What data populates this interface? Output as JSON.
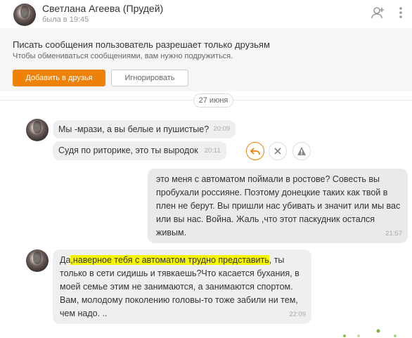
{
  "header": {
    "name": "Светлана Агеева (Прудей)",
    "status": "была в 19:45",
    "icons": [
      "add-user-icon",
      "more-icon"
    ]
  },
  "notice": {
    "title": "Писать сообщения пользователь разрешает только друзьям",
    "subtitle": "Чтобы обмениваться сообщениями, вам нужно подружиться.",
    "add_button": "Добавить в друзья",
    "ignore_button": "Игнорировать"
  },
  "date_separator": "27 июня",
  "messages": [
    {
      "from": "contact",
      "text": "Мы -мрази, а вы белые и пушистые?",
      "time": "20:09"
    },
    {
      "from": "contact",
      "text": "Судя по риторике, это ты выродок",
      "time": "20:11"
    },
    {
      "from": "me",
      "text": "это меня с автоматом поймали в ростове? Совесть вы пробухали россияне. Поэтому донецкие таких как твой в плен не берут. Вы пришли нас убивать и значит или мы вас или вы нас. Война. Жаль ,что этот паскудник остался живым.",
      "time": "21:57"
    },
    {
      "from": "contact",
      "text_before": "Да",
      "text_highlight": ",наверное тебя с автоматом трудно представить",
      "text_after": ", ты только в сети сидишь и тявкаешь?Что касается бухания, в моей семье этим не занимаются, а занимаются спортом. Вам, молодому поколению головы-то тоже забили ни тем, чем надо. ..",
      "time": "22:09"
    }
  ],
  "message_actions": [
    "reply-icon",
    "close-icon",
    "warning-icon"
  ],
  "colors": {
    "accent": "#ee8208",
    "highlight": "#f5f500",
    "bubble": "#efefef"
  }
}
